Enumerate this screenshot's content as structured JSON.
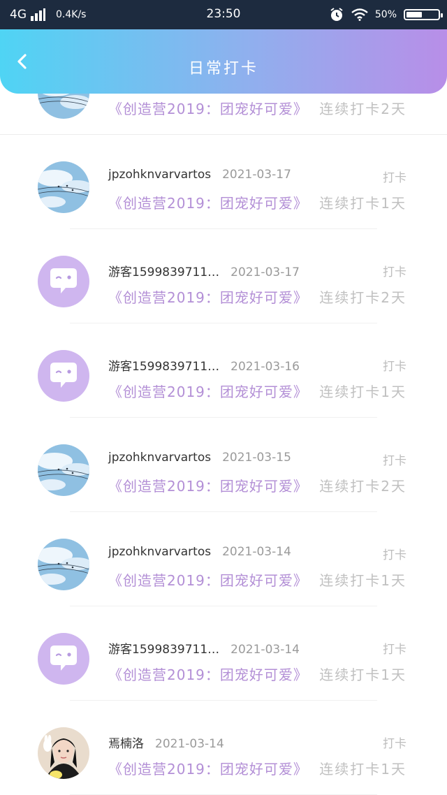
{
  "status_bar": {
    "network": "4G",
    "speed": "0.4K/s",
    "time": "23:50",
    "battery": "50%",
    "battery_level": 0.5
  },
  "header": {
    "title": "日常打卡"
  },
  "partial_item": {
    "topic": "《创造营2019：团宠好可爱》",
    "streak": "连续打卡2天"
  },
  "items": [
    {
      "avatar": "sky-photo",
      "name": "jpzohknvarvartos",
      "date": "2021-03-17",
      "action": "打卡",
      "topic": "《创造营2019：团宠好可爱》",
      "streak": "连续打卡1天"
    },
    {
      "avatar": "chat-bubble",
      "name": "游客1599839711…",
      "date": "2021-03-17",
      "action": "打卡",
      "topic": "《创造营2019：团宠好可爱》",
      "streak": "连续打卡2天"
    },
    {
      "avatar": "chat-bubble",
      "name": "游客1599839711…",
      "date": "2021-03-16",
      "action": "打卡",
      "topic": "《创造营2019：团宠好可爱》",
      "streak": "连续打卡1天"
    },
    {
      "avatar": "sky-photo",
      "name": "jpzohknvarvartos",
      "date": "2021-03-15",
      "action": "打卡",
      "topic": "《创造营2019：团宠好可爱》",
      "streak": "连续打卡2天"
    },
    {
      "avatar": "sky-photo",
      "name": "jpzohknvarvartos",
      "date": "2021-03-14",
      "action": "打卡",
      "topic": "《创造营2019：团宠好可爱》",
      "streak": "连续打卡1天"
    },
    {
      "avatar": "chat-bubble",
      "name": "游客1599839711…",
      "date": "2021-03-14",
      "action": "打卡",
      "topic": "《创造营2019：团宠好可爱》",
      "streak": "连续打卡1天"
    },
    {
      "avatar": "person-photo",
      "name": "焉楠洛",
      "date": "2021-03-14",
      "action": "打卡",
      "topic": "《创造营2019：团宠好可爱》",
      "streak": "连续打卡1天"
    }
  ]
}
